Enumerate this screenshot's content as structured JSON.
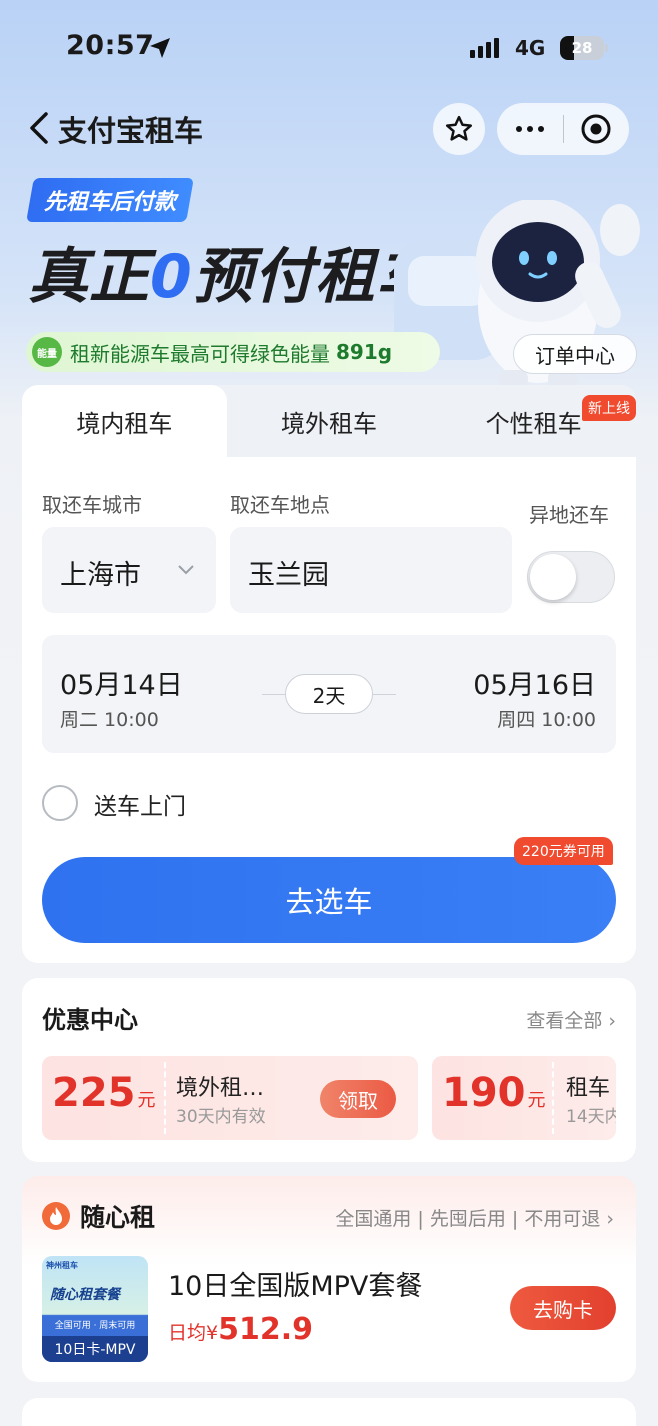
{
  "status": {
    "time": "20:57",
    "network": "4G",
    "battery": "28"
  },
  "nav": {
    "title": "支付宝租车"
  },
  "banner": {
    "tag": "先租车后付款",
    "headline_a": "真正",
    "headline_zero": "0",
    "headline_b": "预付租车",
    "energy_badge": "能量",
    "energy_text": "租新能源车最高可得绿色能量",
    "energy_value": "891g",
    "order_center": "订单中心"
  },
  "tabs": [
    {
      "label": "境内租车"
    },
    {
      "label": "境外租车"
    },
    {
      "label": "个性租车",
      "badge": "新上线"
    }
  ],
  "booking": {
    "city_label": "取还车城市",
    "city_value": "上海市",
    "place_label": "取还车地点",
    "place_value": "玉兰园",
    "diff_return_label": "异地还车",
    "diff_return_on": false,
    "pickup_date": "05月14日",
    "pickup_time": "周二 10:00",
    "duration": "2天",
    "return_date": "05月16日",
    "return_time": "周四 10:00",
    "delivery_label": "送车上门",
    "delivery_checked": false,
    "coupon_tip": "220元券可用",
    "go_button": "去选车"
  },
  "offers": {
    "title": "优惠中心",
    "see_all": "查看全部",
    "coupons": [
      {
        "amount": "225",
        "unit": "元",
        "name": "境外租…",
        "valid": "30天内有效",
        "action": "领取"
      },
      {
        "amount": "190",
        "unit": "元",
        "name": "租车",
        "valid": "14天内"
      }
    ]
  },
  "package": {
    "title": "随心租",
    "tags": "全国通用 | 先囤后用 | 不用可退",
    "thumb_brand": "神州租车",
    "thumb_title": "随心租套餐",
    "thumb_sub": "全国可用 · 周末可用",
    "thumb_foot": "10日卡-MPV",
    "name": "10日全国版MPV套餐",
    "price_label": "日均¥",
    "price_value": "512.9",
    "buy_button": "去购卡"
  },
  "colors": {
    "accent": "#2f72f0",
    "promo_red": "#e2332b",
    "energy_green": "#1e7a2d"
  }
}
